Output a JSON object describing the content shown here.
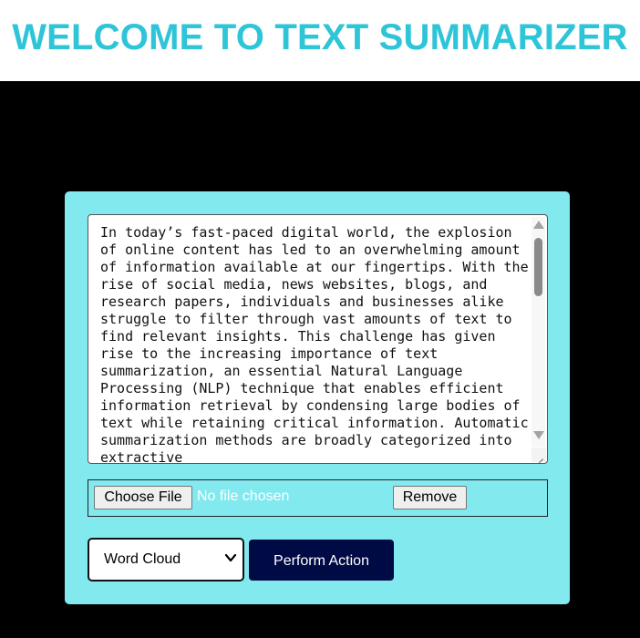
{
  "header": {
    "title": "WELCOME TO TEXT SUMMARIZER"
  },
  "editor": {
    "text": "In today’s fast-paced digital world, the explosion of online content has led to an overwhelming amount of information available at our fingertips. With the rise of social media, news websites, blogs, and research papers, individuals and businesses alike struggle to filter through vast amounts of text to find relevant insights. This challenge has given rise to the increasing importance of text summarization, an essential Natural Language Processing (NLP) technique that enables efficient information retrieval by condensing large bodies of text while retaining critical information. Automatic summarization methods are broadly categorized into extractive"
  },
  "file": {
    "choose_label": "Choose File",
    "status": "No file chosen",
    "remove_label": "Remove"
  },
  "action": {
    "selected_option": "Word Cloud",
    "perform_label": "Perform Action"
  },
  "colors": {
    "title": "#2ec5d8",
    "panel": "#82e9ef",
    "background": "#000000",
    "perform_button": "#000a45"
  }
}
